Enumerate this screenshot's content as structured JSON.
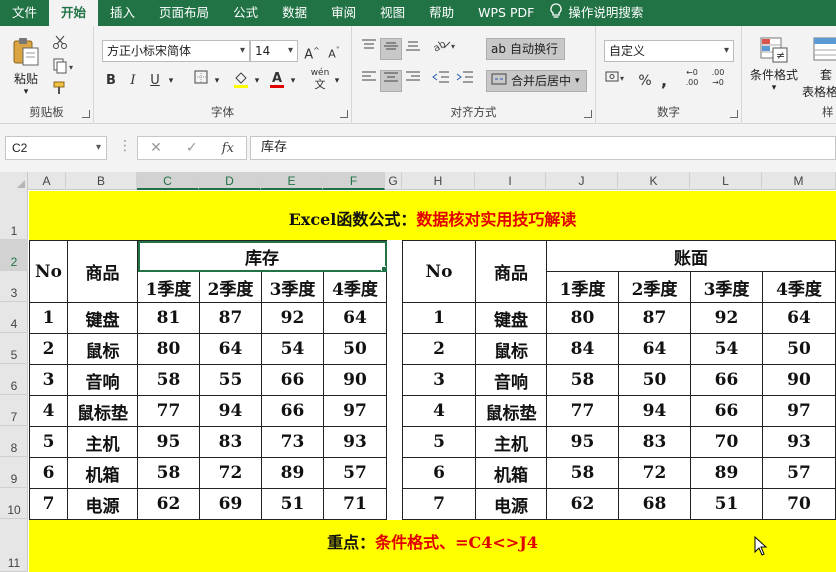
{
  "menu": {
    "items": [
      "文件",
      "开始",
      "插入",
      "页面布局",
      "公式",
      "数据",
      "审阅",
      "视图",
      "帮助",
      "WPS PDF"
    ],
    "active": "开始",
    "tell_me": "操作说明搜索"
  },
  "ribbon": {
    "clipboard": {
      "paste_label": "粘贴",
      "group_label": "剪贴板"
    },
    "font": {
      "font_name": "方正小标宋简体",
      "font_size": "14",
      "bold": "B",
      "italic": "I",
      "underline": "U",
      "wen": "wén",
      "group_label": "字体"
    },
    "alignment": {
      "wrap_text": "自动换行",
      "merge_center": "合并后居中",
      "group_label": "对齐方式"
    },
    "number": {
      "format": "自定义",
      "group_label": "数字"
    },
    "styles": {
      "conditional_format": "条件格式",
      "table_format_short": "套",
      "table_format_rest": "表格格",
      "group_label_partial": "样"
    }
  },
  "formula_bar": {
    "name_box": "C2",
    "content": "库存"
  },
  "sheet": {
    "columns": [
      "A",
      "B",
      "C",
      "D",
      "E",
      "F",
      "G",
      "H",
      "I",
      "J",
      "K",
      "L",
      "M"
    ],
    "selected_columns": [
      "C",
      "D",
      "E",
      "F"
    ],
    "rows": [
      "1",
      "2",
      "3",
      "4",
      "5",
      "6",
      "7",
      "8",
      "9",
      "10",
      "11"
    ],
    "selected_rows": [
      "2"
    ],
    "title": {
      "black": "Excel函数公式：",
      "red": "数据核对实用技巧解读"
    },
    "footer": {
      "black": "重点：",
      "red": "条件格式、=C4<>J4"
    },
    "left_table": {
      "no_header": "No",
      "product_header": "商品",
      "group_header": "库存",
      "quarters": [
        "1季度",
        "2季度",
        "3季度",
        "4季度"
      ],
      "rows": [
        {
          "no": "1",
          "product": "键盘",
          "values": [
            "81",
            "87",
            "92",
            "64"
          ]
        },
        {
          "no": "2",
          "product": "鼠标",
          "values": [
            "80",
            "64",
            "54",
            "50"
          ]
        },
        {
          "no": "3",
          "product": "音响",
          "values": [
            "58",
            "55",
            "66",
            "90"
          ]
        },
        {
          "no": "4",
          "product": "鼠标垫",
          "values": [
            "77",
            "94",
            "66",
            "97"
          ]
        },
        {
          "no": "5",
          "product": "主机",
          "values": [
            "95",
            "83",
            "73",
            "93"
          ]
        },
        {
          "no": "6",
          "product": "机箱",
          "values": [
            "58",
            "72",
            "89",
            "57"
          ]
        },
        {
          "no": "7",
          "product": "电源",
          "values": [
            "62",
            "69",
            "51",
            "71"
          ]
        }
      ]
    },
    "right_table": {
      "no_header": "No",
      "product_header": "商品",
      "group_header": "账面",
      "quarters": [
        "1季度",
        "2季度",
        "3季度",
        "4季度"
      ],
      "rows": [
        {
          "no": "1",
          "product": "键盘",
          "values": [
            "80",
            "87",
            "92",
            "64"
          ]
        },
        {
          "no": "2",
          "product": "鼠标",
          "values": [
            "84",
            "64",
            "54",
            "50"
          ]
        },
        {
          "no": "3",
          "product": "音响",
          "values": [
            "58",
            "50",
            "66",
            "90"
          ]
        },
        {
          "no": "4",
          "product": "鼠标垫",
          "values": [
            "77",
            "94",
            "66",
            "97"
          ]
        },
        {
          "no": "5",
          "product": "主机",
          "values": [
            "95",
            "83",
            "70",
            "93"
          ]
        },
        {
          "no": "6",
          "product": "机箱",
          "values": [
            "58",
            "72",
            "89",
            "57"
          ]
        },
        {
          "no": "7",
          "product": "电源",
          "values": [
            "62",
            "68",
            "51",
            "70"
          ]
        }
      ]
    }
  },
  "colors": {
    "excel_green": "#217346",
    "highlight_yellow": "#ffff00",
    "title_red": "#e00000"
  }
}
